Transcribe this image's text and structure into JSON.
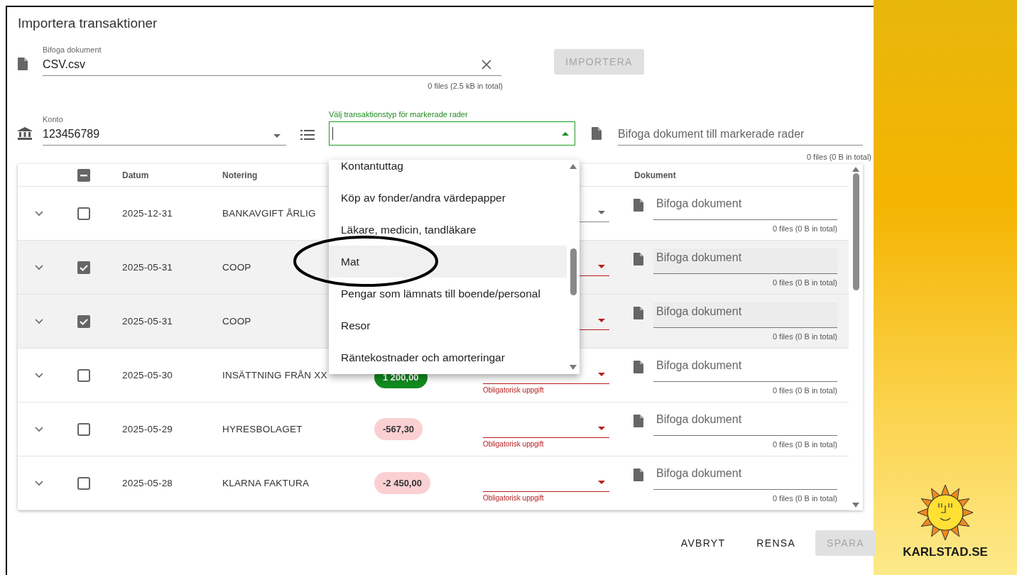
{
  "dialog": {
    "title": "Importera transaktioner"
  },
  "file_field": {
    "label": "Bifoga dokument",
    "value": "CSV.csv",
    "file_info": "0 files (2.5 kB in total)"
  },
  "import_button": {
    "label": "IMPORTERA",
    "disabled": true
  },
  "account_field": {
    "label": "Konto",
    "value": "123456789"
  },
  "type_select": {
    "label": "Välj transaktionstyp för markerade rader",
    "expanded": true
  },
  "bulk_document_field": {
    "placeholder": "Bifoga dokument till markerade rader",
    "file_info": "0 files (0 B in total)"
  },
  "table": {
    "select_all_indeterminate": true,
    "headers": {
      "date": "Datum",
      "note": "Notering",
      "document": "Dokument"
    },
    "rows": [
      {
        "date": "2025-12-31",
        "note": "BANKAVGIFT ÅRLIG",
        "selected": false,
        "type_error": false,
        "doc_placeholder": "Bifoga dokument",
        "file_info": "0 files (0 B in total)"
      },
      {
        "date": "2025-05-31",
        "note": "COOP",
        "selected": true,
        "type_error": true,
        "doc_placeholder": "Bifoga dokument",
        "file_info": "0 files (0 B in total)"
      },
      {
        "date": "2025-05-31",
        "note": "COOP",
        "selected": true,
        "type_error": true,
        "doc_placeholder": "Bifoga dokument",
        "file_info": "0 files (0 B in total)"
      },
      {
        "date": "2025-05-30",
        "note": "INSÄTTNING FRÅN XX",
        "amount": "1 200,00",
        "positive": true,
        "selected": false,
        "type_error": true,
        "type_error_text": "Obligatorisk uppgift",
        "doc_placeholder": "Bifoga dokument",
        "file_info": "0 files (0 B in total)"
      },
      {
        "date": "2025-05-29",
        "note": "HYRESBOLAGET",
        "amount": "-567,30",
        "positive": false,
        "selected": false,
        "type_error": true,
        "type_error_text": "Obligatorisk uppgift",
        "doc_placeholder": "Bifoga dokument",
        "file_info": "0 files (0 B in total)"
      },
      {
        "date": "2025-05-28",
        "note": "KLARNA FAKTURA",
        "amount": "-2 450,00",
        "positive": false,
        "selected": false,
        "type_error": true,
        "type_error_text": "Obligatorisk uppgift",
        "doc_placeholder": "Bifoga dokument",
        "file_info": "0 files (0 B in total)"
      }
    ]
  },
  "dropdown": {
    "options": [
      {
        "label": "Kontantuttag",
        "highlighted": false,
        "circled": false
      },
      {
        "label": "Köp av fonder/andra värdepapper",
        "highlighted": false,
        "circled": false
      },
      {
        "label": "Läkare, medicin, tandläkare",
        "highlighted": false,
        "circled": false
      },
      {
        "label": "Mat",
        "highlighted": true,
        "circled": true
      },
      {
        "label": "Pengar som lämnats till boende/personal",
        "highlighted": false,
        "circled": false
      },
      {
        "label": "Resor",
        "highlighted": false,
        "circled": false
      },
      {
        "label": "Räntekostnader och amorteringar",
        "highlighted": false,
        "circled": false
      }
    ]
  },
  "footer": {
    "buttons": [
      {
        "label": "AVBRYT",
        "disabled": false
      },
      {
        "label": "RENSA",
        "disabled": false
      },
      {
        "label": "SPARA",
        "disabled": true
      }
    ]
  },
  "brand": {
    "name": "KARLSTAD.SE"
  }
}
